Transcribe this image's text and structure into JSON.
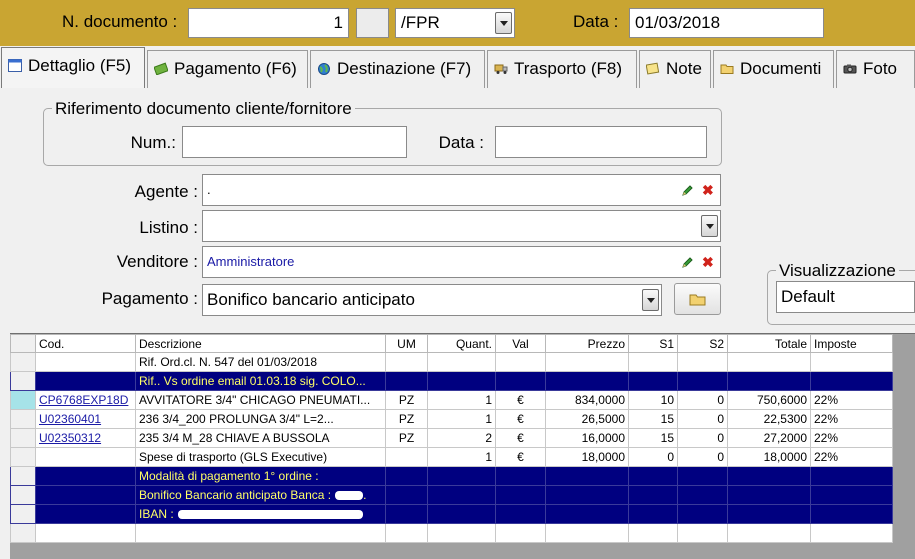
{
  "header": {
    "doc_label": "N. documento :",
    "doc_number": "1",
    "doc_suffix": "",
    "doc_series": "/FPR",
    "date_label": "Data :",
    "date_value": "01/03/2018"
  },
  "tabs": [
    {
      "label": "Dettaglio (F5)",
      "icon": "calendar-icon",
      "active": true
    },
    {
      "label": "Pagamento (F6)",
      "icon": "money-icon"
    },
    {
      "label": "Destinazione (F7)",
      "icon": "globe-icon"
    },
    {
      "label": "Trasporto (F8)",
      "icon": "truck-icon"
    },
    {
      "label": "Note",
      "icon": "note-icon"
    },
    {
      "label": "Documenti",
      "icon": "folder-icon"
    },
    {
      "label": "Foto",
      "icon": "camera-icon"
    }
  ],
  "reference": {
    "title": "Riferimento documento cliente/fornitore",
    "num_label": "Num.:",
    "num_value": "",
    "date_label": "Data :",
    "date_value": ""
  },
  "form": {
    "agente_label": "Agente :",
    "agente_value": ".",
    "listino_label": "Listino :",
    "listino_value": "",
    "venditore_label": "Venditore :",
    "venditore_value": "Amministratore",
    "pagamento_label": "Pagamento :",
    "pagamento_value": "Bonifico bancario anticipato"
  },
  "visualizzazione": {
    "title": "Visualizzazione",
    "value": "Default"
  },
  "grid": {
    "columns": [
      "Cod.",
      "Descrizione",
      "UM",
      "Quant.",
      "Val",
      "Prezzo",
      "S1",
      "S2",
      "Totale",
      "Imposte"
    ],
    "rows": [
      {
        "type": "plain",
        "cod": "",
        "desc": "Rif. Ord.cl. N. 547 del 01/03/2018",
        "um": "",
        "qty": "",
        "val": "",
        "price": "",
        "s1": "",
        "s2": "",
        "total": "",
        "tax": ""
      },
      {
        "type": "blue",
        "cod": "",
        "desc": "Rif.. Vs ordine email 01.03.18 sig. COLO...",
        "um": "",
        "qty": "",
        "val": "",
        "price": "",
        "s1": "",
        "s2": "",
        "total": "",
        "tax": ""
      },
      {
        "type": "item",
        "current": true,
        "cod": "CP6768EXP18D",
        "desc": "AVVITATORE 3/4\" CHICAGO PNEUMATI...",
        "um": "PZ",
        "qty": "1",
        "val": "€",
        "price": "834,0000",
        "s1": "10",
        "s2": "0",
        "total": "750,6000",
        "tax": "22%"
      },
      {
        "type": "item",
        "cod": "U02360401",
        "desc": "236 3/4_200  PROLUNGA          3/4\" L=2...",
        "um": "PZ",
        "qty": "1",
        "val": "€",
        "price": "26,5000",
        "s1": "15",
        "s2": "0",
        "total": "22,5300",
        "tax": "22%"
      },
      {
        "type": "item",
        "cod": "U02350312",
        "desc": "235 3/4 M_28  CHIAVE A BUSSOLA",
        "um": "PZ",
        "qty": "2",
        "val": "€",
        "price": "16,0000",
        "s1": "15",
        "s2": "0",
        "total": "27,2000",
        "tax": "22%"
      },
      {
        "type": "plain",
        "cod": "",
        "desc": "Spese di trasporto (GLS Executive)",
        "um": "",
        "qty": "1",
        "val": "€",
        "price": "18,0000",
        "s1": "0",
        "s2": "0",
        "total": "18,0000",
        "tax": "22%"
      },
      {
        "type": "blue",
        "cod": "",
        "desc": "Modalità di pagamento 1° ordine :",
        "um": "",
        "qty": "",
        "val": "",
        "price": "",
        "s1": "",
        "s2": "",
        "total": "",
        "tax": ""
      },
      {
        "type": "blue",
        "cod": "",
        "desc": "Bonifico Bancario anticipato Banca :",
        "um": "",
        "qty": "",
        "val": "",
        "price": "",
        "s1": "",
        "s2": "",
        "total": "",
        "tax": "",
        "masked": "."
      },
      {
        "type": "blue",
        "cod": "",
        "desc": "IBAN :",
        "um": "",
        "qty": "",
        "val": "",
        "price": "",
        "s1": "",
        "s2": "",
        "total": "",
        "tax": "",
        "masked": ""
      },
      {
        "type": "empty",
        "cod": "",
        "desc": "",
        "um": "",
        "qty": "",
        "val": "",
        "price": "",
        "s1": "",
        "s2": "",
        "total": "",
        "tax": ""
      }
    ]
  }
}
